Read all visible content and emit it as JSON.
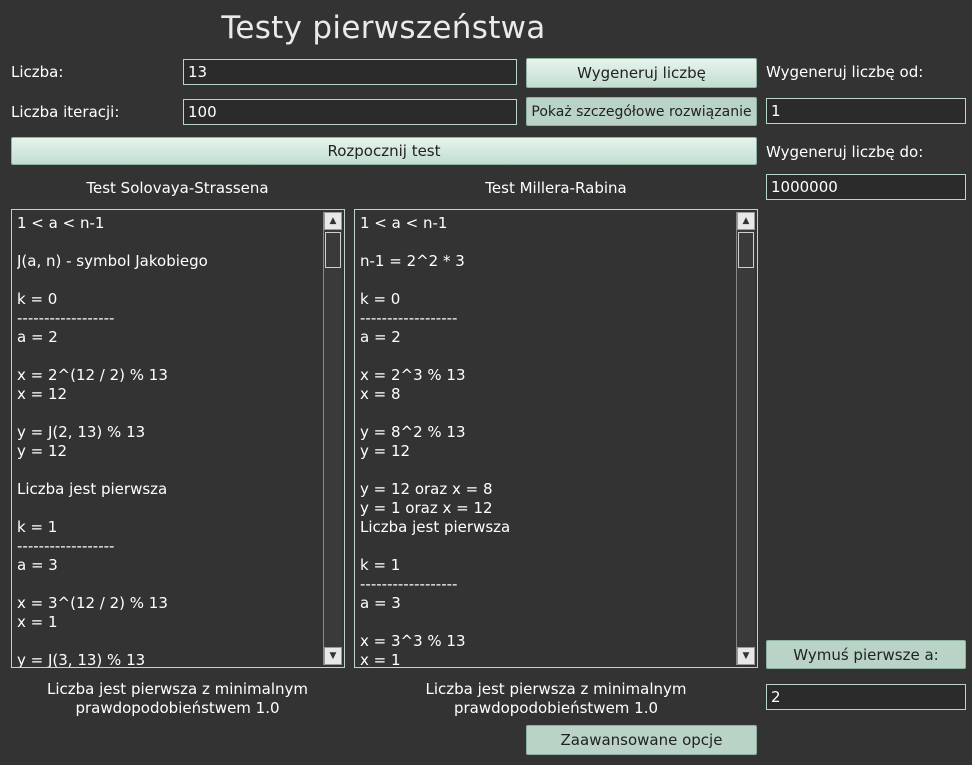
{
  "title": "Testy pierwszeństwa",
  "form": {
    "number_label": "Liczba:",
    "number_value": "13",
    "iterations_label": "Liczba iteracji:",
    "iterations_value": "100",
    "generate_button": "Wygeneruj liczbę",
    "details_button": "Pokaż szczegółowe rozwiązanie",
    "start_button": "Rozpocznij test"
  },
  "side": {
    "from_label": "Wygeneruj liczbę  od:",
    "from_value": "1",
    "to_label": "Wygeneruj liczbę do:",
    "to_value": "1000000",
    "force_button": "Wymuś pierwsze a:",
    "force_value": "2",
    "advanced_button": "Zaawansowane opcje"
  },
  "solovay": {
    "heading": "Test Solovaya-Strassena",
    "text": "1 < a < n-1\n\nJ(a, n) - symbol Jakobiego\n\nk = 0\n------------------\na = 2\n\nx = 2^(12 / 2) % 13\nx = 12\n\ny = J(2, 13) % 13\ny = 12\n\nLiczba jest pierwsza\n\nk = 1\n------------------\na = 3\n\nx = 3^(12 / 2) % 13\nx = 1\n\ny = J(3, 13) % 13",
    "result": "Liczba jest pierwsza z minimalnym\nprawdopodobieństwem 1.0"
  },
  "miller": {
    "heading": "Test Millera-Rabina",
    "text": "1 < a < n-1\n\nn-1 = 2^2 * 3\n\nk = 0\n------------------\na = 2\n\nx = 2^3 % 13\nx = 8\n\ny = 8^2 % 13\ny = 12\n\ny = 12 oraz x = 8\ny = 1 oraz x = 12\nLiczba jest pierwsza\n\nk = 1\n------------------\na = 3\n\nx = 3^3 % 13\nx = 1",
    "result": "Liczba jest pierwsza z minimalnym\nprawdopodobieństwem 1.0"
  },
  "icons": {
    "scroll_up": "triangle-up",
    "scroll_down": "triangle-down"
  },
  "colors": {
    "background": "#333333",
    "input_border": "#b9d6c9",
    "button": "#c3ddd1"
  }
}
